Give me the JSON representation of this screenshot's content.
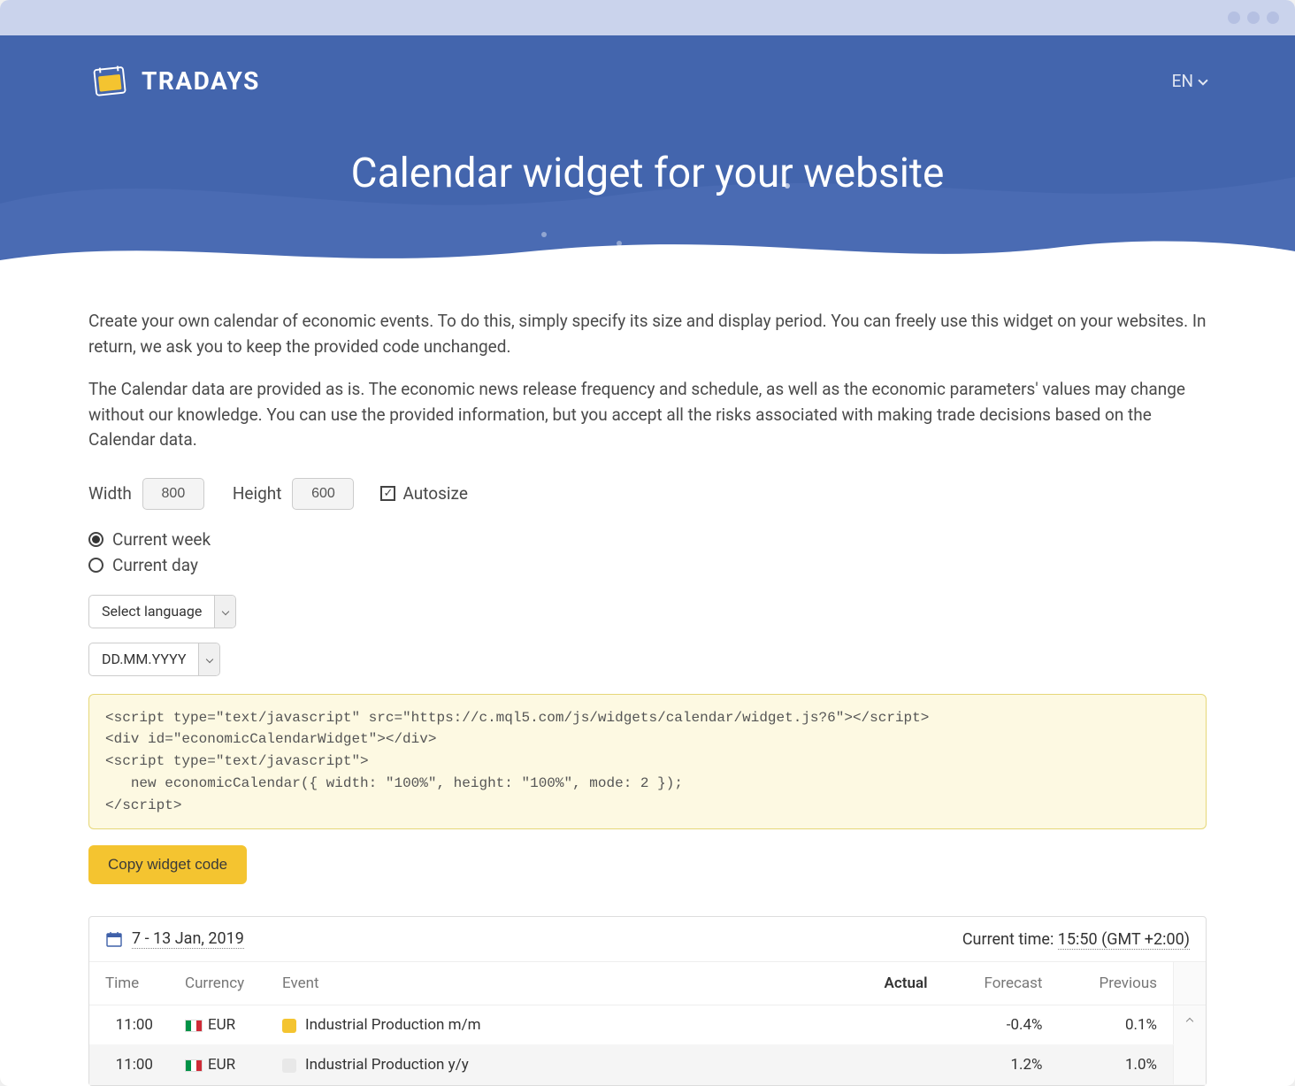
{
  "brand": {
    "name": "TRADAYS"
  },
  "lang": {
    "current": "EN"
  },
  "hero": {
    "title": "Calendar widget for your website"
  },
  "intro": {
    "p1": "Create your own calendar of economic events. To do this, simply specify its size and display period. You can freely use this widget on your websites. In return, we ask you to keep the provided code unchanged.",
    "p2": "The Calendar data are provided as is. The economic news release frequency and schedule, as well as the economic parameters' values may change without our knowledge. You can use the provided information, but you accept all the risks associated with making trade decisions based on the Calendar data."
  },
  "size": {
    "width_label": "Width",
    "width_value": "800",
    "height_label": "Height",
    "height_value": "600",
    "autosize_label": "Autosize"
  },
  "period": {
    "week_label": "Current week",
    "day_label": "Current day"
  },
  "dropdowns": {
    "language": "Select language",
    "date_format": "DD.MM.YYYY"
  },
  "code_snippet": "<script type=\"text/javascript\" src=\"https://c.mql5.com/js/widgets/calendar/widget.js?6\"></script>\n<div id=\"economicCalendarWidget\"></div>\n<script type=\"text/javascript\">\n   new economicCalendar({ width: \"100%\", height: \"100%\", mode: 2 });\n</script>",
  "copy_btn": "Copy widget code",
  "calendar": {
    "date_range": "7 - 13 Jan, 2019",
    "current_time_label": "Current time:",
    "current_time_value": "15:50 (GMT +2:00)",
    "headers": {
      "time": "Time",
      "currency": "Currency",
      "event": "Event",
      "actual": "Actual",
      "forecast": "Forecast",
      "previous": "Previous"
    },
    "rows": [
      {
        "time": "11:00",
        "currency": "EUR",
        "event": "Industrial Production m/m",
        "actual": "",
        "forecast": "-0.4%",
        "previous": "0.1%",
        "imp": "med"
      },
      {
        "time": "11:00",
        "currency": "EUR",
        "event": "Industrial Production y/y",
        "actual": "",
        "forecast": "1.2%",
        "previous": "1.0%",
        "imp": "low"
      }
    ]
  }
}
